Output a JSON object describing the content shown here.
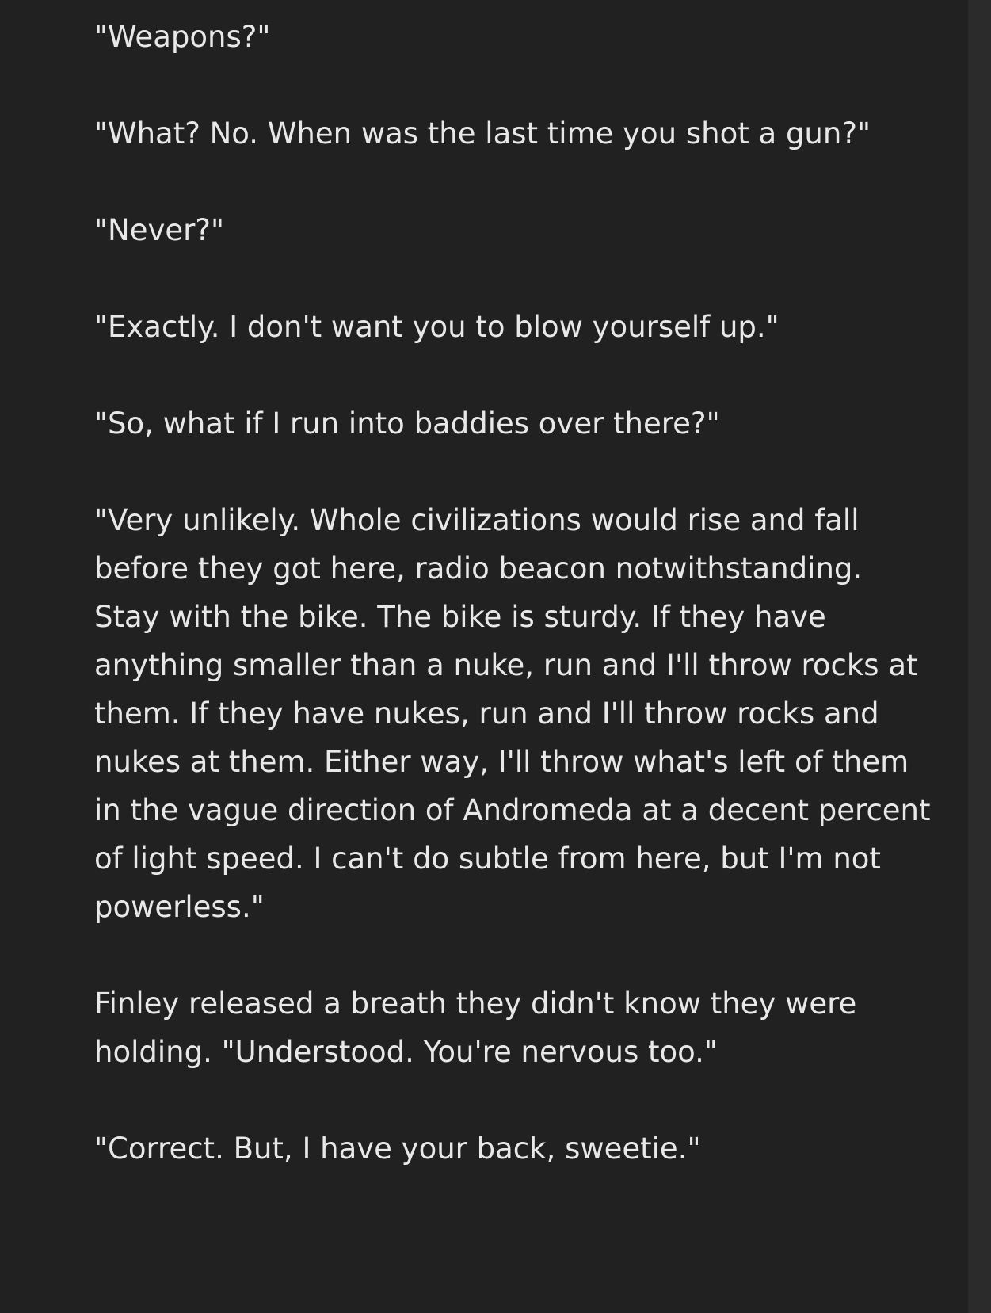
{
  "paragraphs": [
    "\"Weapons?\"",
    "\"What? No. When was the last time you shot a gun?\"",
    "\"Never?\"",
    "\"Exactly. I don't want you to blow yourself up.\"",
    "\"So, what if I run into baddies over there?\"",
    "\"Very unlikely. Whole civilizations would rise and fall before they got here, radio beacon notwithstanding. Stay with the bike. The bike is sturdy. If they have anything smaller than a nuke, run and I'll throw rocks at them. If they have nukes, run and I'll throw rocks and nukes at them. Either way, I'll throw what's left of them in the vague direction of Andromeda at a decent percent of light speed. I can't do subtle from here, but I'm not powerless.\"",
    "Finley released a breath they didn't know they were holding. \"Understood. You're nervous too.\"",
    "\"Correct. But, I have your back, sweetie.\""
  ]
}
